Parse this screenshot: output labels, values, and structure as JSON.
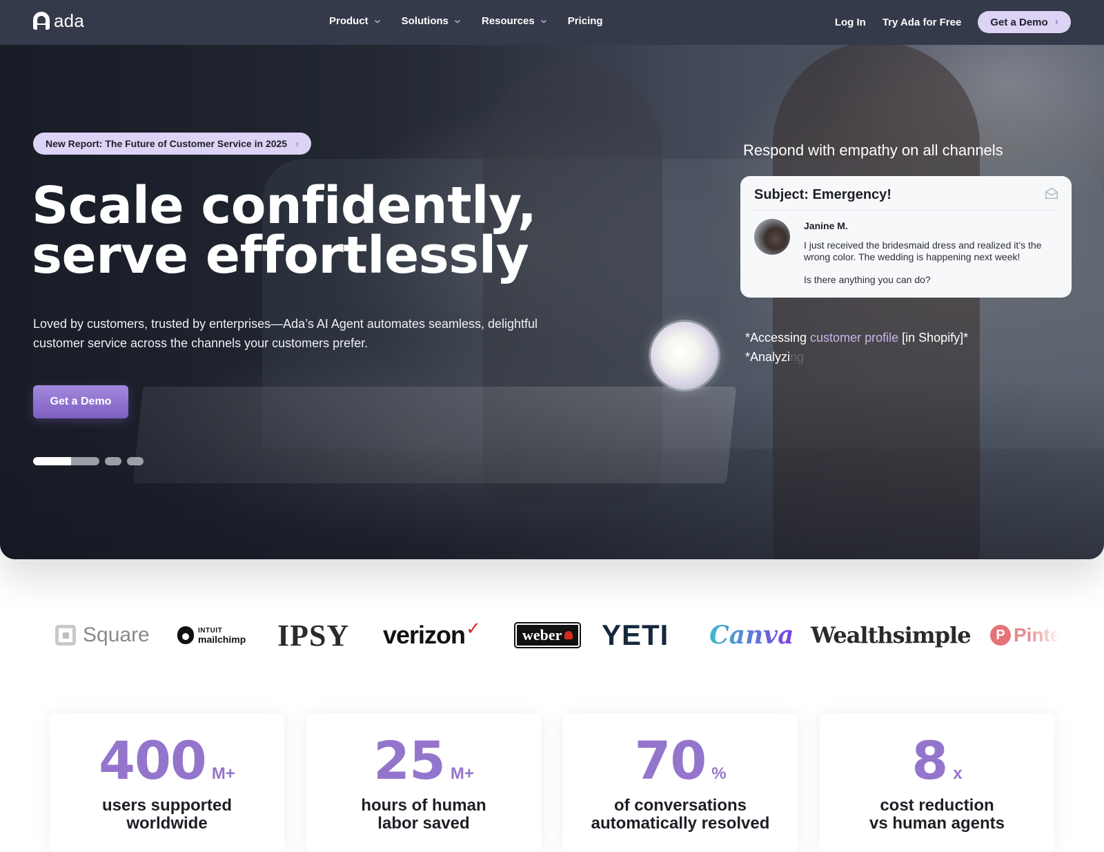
{
  "nav": {
    "logo_text": "ada",
    "menu": [
      {
        "label": "Product",
        "has_dropdown": true
      },
      {
        "label": "Solutions",
        "has_dropdown": true
      },
      {
        "label": "Resources",
        "has_dropdown": true
      },
      {
        "label": "Pricing",
        "has_dropdown": false
      }
    ],
    "login": "Log In",
    "try_free": "Try Ada for Free",
    "cta": "Get a Demo",
    "cta_arrow": "›"
  },
  "hero": {
    "report_pill": "New Report: The Future of Customer Service in 2025",
    "report_arrow": "›",
    "headline_line1": "Scale confidently,",
    "headline_line2": "serve effortlessly",
    "subtext": "Loved by customers, trusted by enterprises—Ada’s AI Agent automates seamless, delightful customer service across the channels your customers prefer.",
    "cta": "Get a Demo",
    "carousel": {
      "slides": 3,
      "active_index": 0,
      "active_progress": 0.57
    }
  },
  "demo": {
    "caption": "Respond with empathy on all channels",
    "email": {
      "subject": "Subject: Emergency!",
      "icon": "envelope-open-icon",
      "sender": "Janine M.",
      "body": "I just received the bridesmaid dress and realized it’s the wrong color. The wedding is happening next week!",
      "question": "Is there anything you can do?"
    },
    "ai_status": {
      "line1_prefix": "*Accessing ",
      "line1_highlight": "customer profile",
      "line1_suffix": " [in Shopify]*",
      "line2_typed": "*Analyzi",
      "line2_ghost": "ng"
    }
  },
  "logos": [
    {
      "name": "Square",
      "text": "Square"
    },
    {
      "name": "Intuit Mailchimp",
      "text_top": "INTUIT",
      "text_bottom": "mailchimp"
    },
    {
      "name": "IPSY",
      "text": "IPSY"
    },
    {
      "name": "Verizon",
      "text": "verizon",
      "mark": "✓"
    },
    {
      "name": "Weber",
      "text": "weber"
    },
    {
      "name": "YETI",
      "text": "YETI"
    },
    {
      "name": "Canva",
      "text": "Canva"
    },
    {
      "name": "Wealthsimple",
      "text": "Wealthsimple"
    },
    {
      "name": "Pinterest",
      "text": "Pinte",
      "mark": "P"
    }
  ],
  "stats": [
    {
      "value": "400",
      "unit": "M+",
      "label_line1": "users supported",
      "label_line2": "worldwide"
    },
    {
      "value": "25",
      "unit": "M+",
      "label_line1": "hours of human",
      "label_line2": "labor saved"
    },
    {
      "value": "70",
      "unit": "%",
      "label_line1": "of conversations",
      "label_line2": "automatically resolved"
    },
    {
      "value": "8",
      "unit": "x",
      "label_line1": "cost reduction",
      "label_line2": "vs human agents"
    }
  ],
  "colors": {
    "nav_bg": "#353a4a",
    "accent_purple": "#9475cc",
    "pill_bg": "#dcd3f5",
    "cta_gradient_top": "#a389dd",
    "cta_gradient_bottom": "#7d5fc1"
  }
}
